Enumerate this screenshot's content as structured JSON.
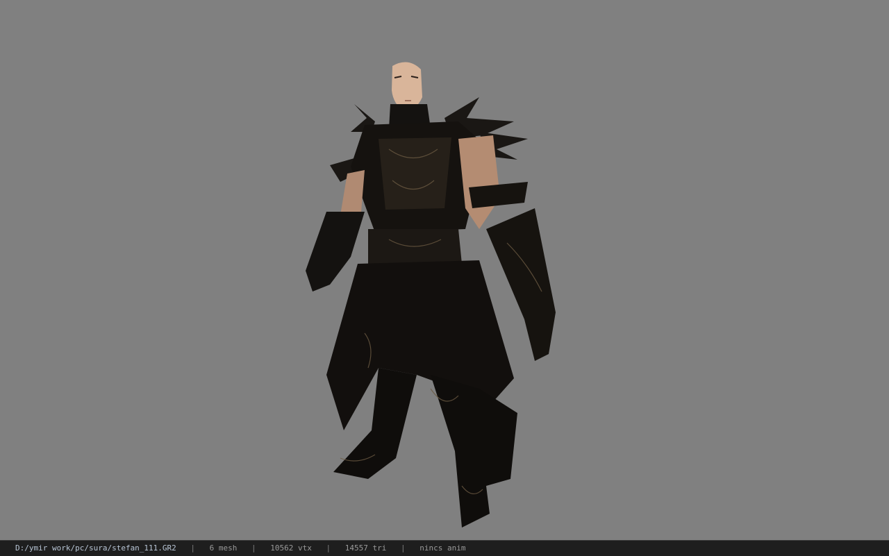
{
  "viewer": {
    "background_color": "#808080",
    "model_icon": "character-model-icon"
  },
  "statusbar": {
    "file_path": "D:/ymir work/pc/sura/stefan_111.GR2",
    "separator": "|",
    "mesh": "6 mesh",
    "vertices": "10562 vtx",
    "triangles": "14557 tri",
    "animation": "nincs anim"
  }
}
